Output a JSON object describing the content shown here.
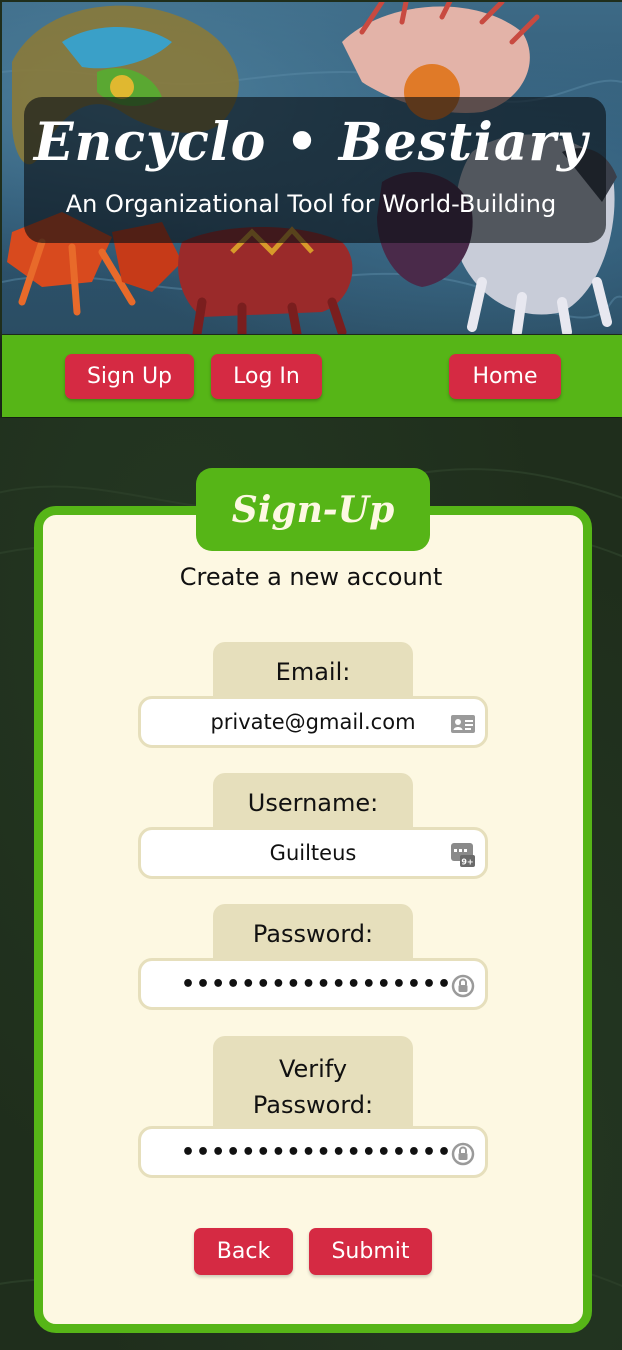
{
  "header": {
    "title": "Encyclo • Bestiary",
    "subtitle": "An Organizational Tool for World-Building"
  },
  "nav": {
    "signup_label": "Sign Up",
    "login_label": "Log In",
    "home_label": "Home"
  },
  "form": {
    "tab_title": "Sign-Up",
    "subtitle": "Create a new account",
    "fields": [
      {
        "label": "Email:",
        "value": "private@gmail.com",
        "icon": "contact-card-icon"
      },
      {
        "label": "Username:",
        "value": "Guilteus",
        "icon": "counter-badge-icon"
      },
      {
        "label": "Password:",
        "value": "••••••••••••••••••",
        "icon": "key-lock-icon"
      },
      {
        "label": "Verify Password:",
        "value": "••••••••••••••••••",
        "icon": "key-lock-icon"
      }
    ],
    "back_label": "Back",
    "submit_label": "Submit"
  },
  "colors": {
    "accent_green": "#56b517",
    "button_red": "#d52a43",
    "card_bg": "#fdf8e2",
    "label_bg": "#e6dfbc",
    "page_bg": "#1f2e1c"
  }
}
